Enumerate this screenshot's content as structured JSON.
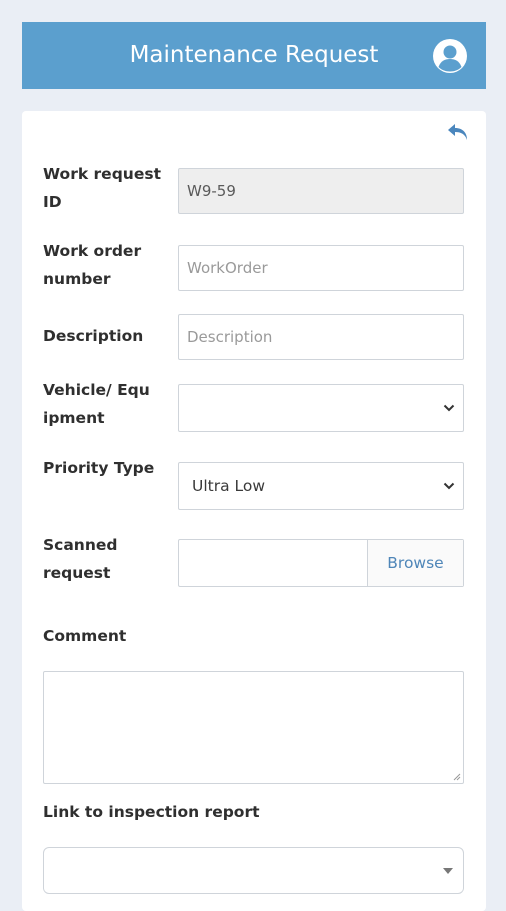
{
  "header": {
    "title": "Maintenance Request",
    "color": "#5b9fce",
    "user_icon": "user-circle-icon"
  },
  "form": {
    "back_icon": "reply-arrow-icon",
    "work_request_id": {
      "label": "Work request ID",
      "value": "W9-59"
    },
    "work_order_number": {
      "label": "Work order number",
      "placeholder": "WorkOrder"
    },
    "description": {
      "label": "Description",
      "placeholder": "Description"
    },
    "vehicle_equipment": {
      "label": "Vehicle/ Equ ipment",
      "value": ""
    },
    "priority_type": {
      "label": "Priority Type",
      "value": "Ultra Low"
    },
    "scanned_request": {
      "label": "Scanned request",
      "button": "Browse"
    },
    "comment": {
      "label": "Comment"
    },
    "link_inspection": {
      "label": "Link to inspection report",
      "value": ""
    }
  }
}
